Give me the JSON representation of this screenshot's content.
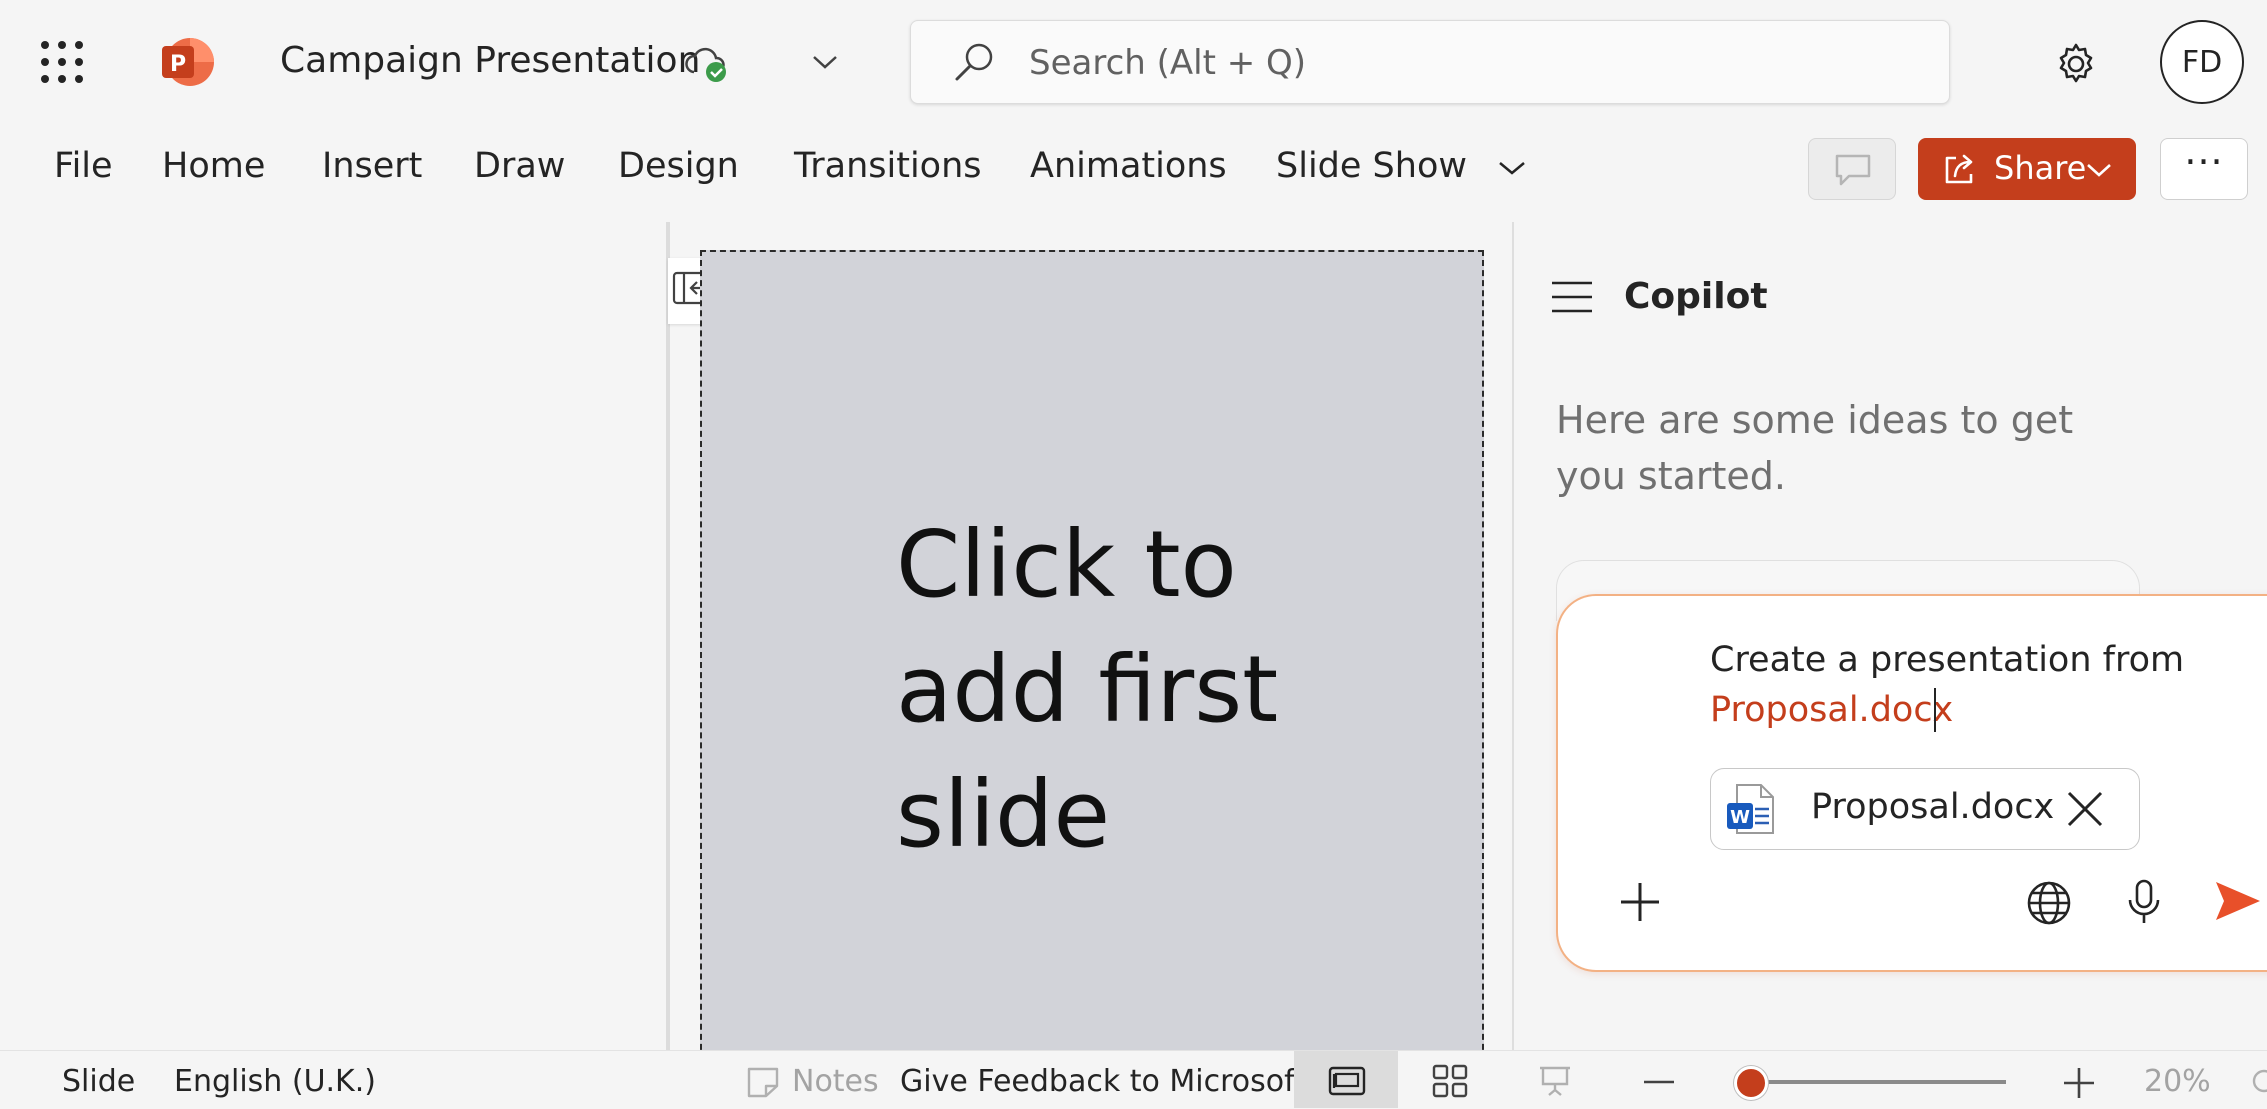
{
  "app": {
    "name": "PowerPoint",
    "brand_color": "#c43e1c"
  },
  "titlebar": {
    "doc_title": "Campaign Presentation",
    "search_placeholder": "Search (Alt + Q)",
    "avatar_initials": "FD"
  },
  "ribbon": {
    "tabs": [
      "File",
      "Home",
      "Insert",
      "Draw",
      "Design",
      "Transitions",
      "Animations",
      "Slide Show"
    ],
    "share_label": "Share",
    "more_label": "···"
  },
  "slide": {
    "placeholder": "Click to\nadd first\nslide"
  },
  "copilot": {
    "title": "Copilot",
    "hint": "Here are some ideas to get you started.",
    "prompt_text": "Create a presentation from",
    "prompt_reference": "Proposal.docx",
    "attachment_name": "Proposal.docx"
  },
  "statusbar": {
    "slide_label": "Slide",
    "language": "English (U.K.)",
    "notes_label": "Notes",
    "feedback": "Give Feedback to Microsoft",
    "zoom_level": "20%"
  }
}
